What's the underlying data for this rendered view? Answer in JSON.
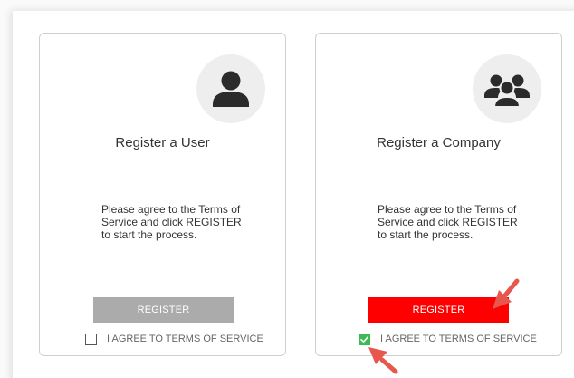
{
  "colors": {
    "register_disabled": "#ababab",
    "register_enabled": "#ff0000",
    "checkbox_checked": "#3cba54",
    "arrow": "#e8574e"
  },
  "cards": [
    {
      "id": "user",
      "icon": "user-icon",
      "title": "Register a User",
      "description": "Please agree to the Terms of Service and click REGISTER to start the process.",
      "register_label": "REGISTER",
      "agree_label": "I AGREE TO TERMS OF SERVICE",
      "agree_checked": false
    },
    {
      "id": "company",
      "icon": "group-icon",
      "title": "Register a Company",
      "description": "Please agree to the Terms of Service and click REGISTER to start the process.",
      "register_label": "REGISTER",
      "agree_label": "I AGREE TO TERMS OF SERVICE",
      "agree_checked": true
    }
  ],
  "annotations": {
    "arrows": [
      "arrow-icon",
      "arrow-icon"
    ]
  }
}
